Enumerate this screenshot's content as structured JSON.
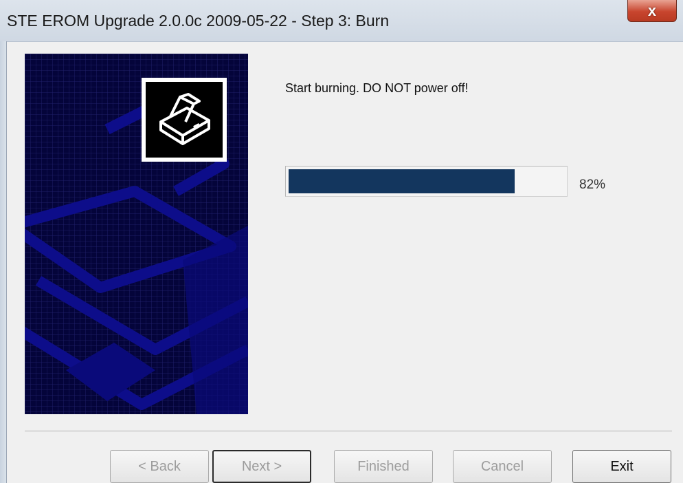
{
  "window": {
    "title": "STE EROM Upgrade 2.0.0c 2009-05-22 - Step 3: Burn",
    "close_glyph": "x"
  },
  "icons": {
    "banner_icon": "printer-icon",
    "close_icon": "close-icon"
  },
  "colors": {
    "banner_background": "#04043a",
    "progress_fill": "#13365e",
    "close_button": "#c8452e"
  },
  "status": {
    "message": "Start burning. DO NOT power off!",
    "progress_fraction": 0.82,
    "percent_label": "82%"
  },
  "buttons": {
    "back": {
      "label": "< Back",
      "enabled": false
    },
    "next": {
      "label": "Next >",
      "enabled": false
    },
    "finished": {
      "label": "Finished",
      "enabled": false
    },
    "cancel": {
      "label": "Cancel",
      "enabled": false
    },
    "exit": {
      "label": "Exit",
      "enabled": true
    }
  }
}
